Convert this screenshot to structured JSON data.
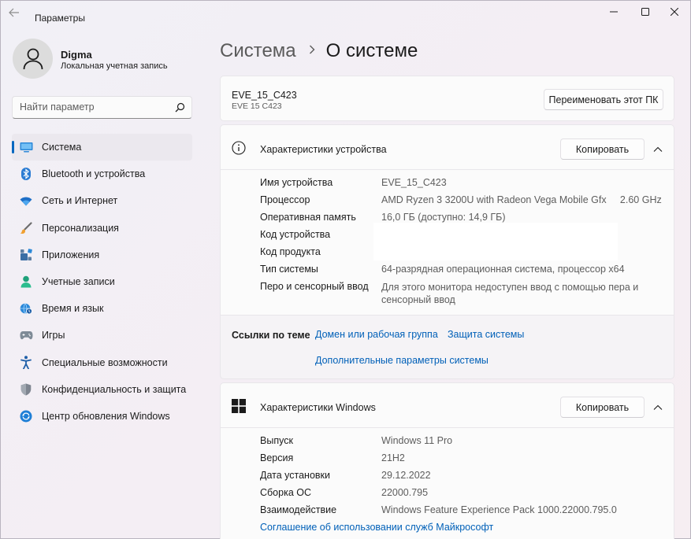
{
  "app": {
    "title": "Параметры"
  },
  "profile": {
    "name": "Digma",
    "account": "Локальная учетная запись"
  },
  "search": {
    "placeholder": "Найти параметр"
  },
  "nav": {
    "items": [
      {
        "label": "Система",
        "icon": "monitor-icon",
        "active": true
      },
      {
        "label": "Bluetooth и устройства",
        "icon": "bluetooth-icon"
      },
      {
        "label": "Сеть и Интернет",
        "icon": "wifi-icon"
      },
      {
        "label": "Персонализация",
        "icon": "brush-icon"
      },
      {
        "label": "Приложения",
        "icon": "apps-icon"
      },
      {
        "label": "Учетные записи",
        "icon": "person-icon"
      },
      {
        "label": "Время и язык",
        "icon": "globe-clock-icon"
      },
      {
        "label": "Игры",
        "icon": "gamepad-icon"
      },
      {
        "label": "Специальные возможности",
        "icon": "accessibility-icon"
      },
      {
        "label": "Конфиденциальность и защита",
        "icon": "shield-icon"
      },
      {
        "label": "Центр обновления Windows",
        "icon": "update-icon"
      }
    ]
  },
  "breadcrumb": {
    "parent": "Система",
    "current": "О системе"
  },
  "pc": {
    "name": "EVE_15_C423",
    "model": "EVE 15 C423",
    "rename_label": "Переименовать этот ПК"
  },
  "device_specs": {
    "title": "Характеристики устройства",
    "copy_label": "Копировать",
    "rows": [
      {
        "label": "Имя устройства",
        "value": "EVE_15_C423"
      },
      {
        "label": "Процессор",
        "value": "AMD Ryzen 3 3200U with Radeon Vega Mobile Gfx     2.60 GHz"
      },
      {
        "label": "Оперативная память",
        "value": "16,0 ГБ (доступно: 14,9 ГБ)"
      },
      {
        "label": "Код устройства",
        "value": ""
      },
      {
        "label": "Код продукта",
        "value": ""
      },
      {
        "label": "Тип системы",
        "value": "64-разрядная операционная система, процессор x64"
      },
      {
        "label": "Перо и сенсорный ввод",
        "value": "Для этого монитора недоступен ввод с помощью пера и сенсорный ввод"
      }
    ]
  },
  "related_links": {
    "label": "Ссылки по теме",
    "domain": "Домен или рабочая группа",
    "protection": "Защита системы",
    "advanced": "Дополнительные параметры системы"
  },
  "windows_specs": {
    "title": "Характеристики Windows",
    "copy_label": "Копировать",
    "rows": [
      {
        "label": "Выпуск",
        "value": "Windows 11 Pro"
      },
      {
        "label": "Версия",
        "value": "21H2"
      },
      {
        "label": "Дата установки",
        "value": "29.12.2022"
      },
      {
        "label": "Сборка ОС",
        "value": "22000.795"
      },
      {
        "label": "Взаимодействие",
        "value": "Windows Feature Experience Pack 1000.22000.795.0"
      }
    ],
    "agreement_link": "Соглашение об использовании служб Майкрософт"
  },
  "colors": {
    "accent": "#0067c0",
    "link": "#0060b8"
  }
}
